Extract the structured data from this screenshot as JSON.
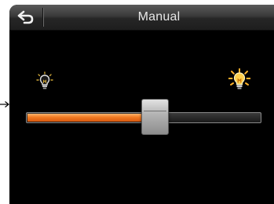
{
  "header": {
    "title": "Manual"
  },
  "icons": {
    "back": "back-arrow-icon",
    "brightness_low": "dim-bulb-icon",
    "brightness_high": "bright-bulb-icon"
  },
  "brightness_slider": {
    "value": 0.55
  },
  "colors": {
    "accent": "#f07a22",
    "background": "#000000",
    "title_text": "#e8e8e8"
  }
}
